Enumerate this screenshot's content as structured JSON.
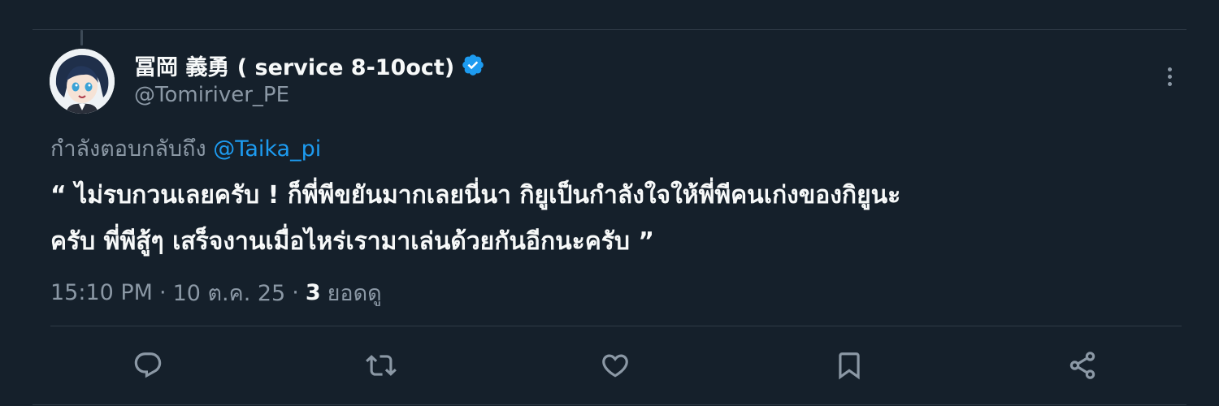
{
  "tweet": {
    "author": {
      "display_name": "冨岡 義勇 ( service 8-10oct)",
      "handle": "@Tomiriver_PE",
      "verified": true,
      "verified_color": "#1d9bf0"
    },
    "reply_prefix": "กำลังตอบกลับถึง",
    "reply_to": "@Taika_pi",
    "text_line1": "“ ไม่รบกวนเลยครับ ! ก็พี่พีขยันมากเลยนี่นา กิยูเป็นกำลังใจให้พี่พีคนเก่งของกิยูนะ",
    "text_line2": "ครับ พี่พีสู้ๆ เสร็จงานเมื่อไหร่เรามาเล่นด้วยกันอีกนะครับ ”",
    "time": "15:10 PM",
    "date": "10 ต.ค. 25",
    "views_count": "3",
    "views_label": "ยอดดู",
    "separator": "·"
  },
  "actions": {
    "reply": "reply-icon",
    "retweet": "retweet-icon",
    "like": "heart-icon",
    "bookmark": "bookmark-icon",
    "share": "share-icon"
  },
  "colors": {
    "background": "#15202b",
    "text": "#f7f9f9",
    "secondary": "#8b98a5",
    "link": "#1d9bf0"
  }
}
